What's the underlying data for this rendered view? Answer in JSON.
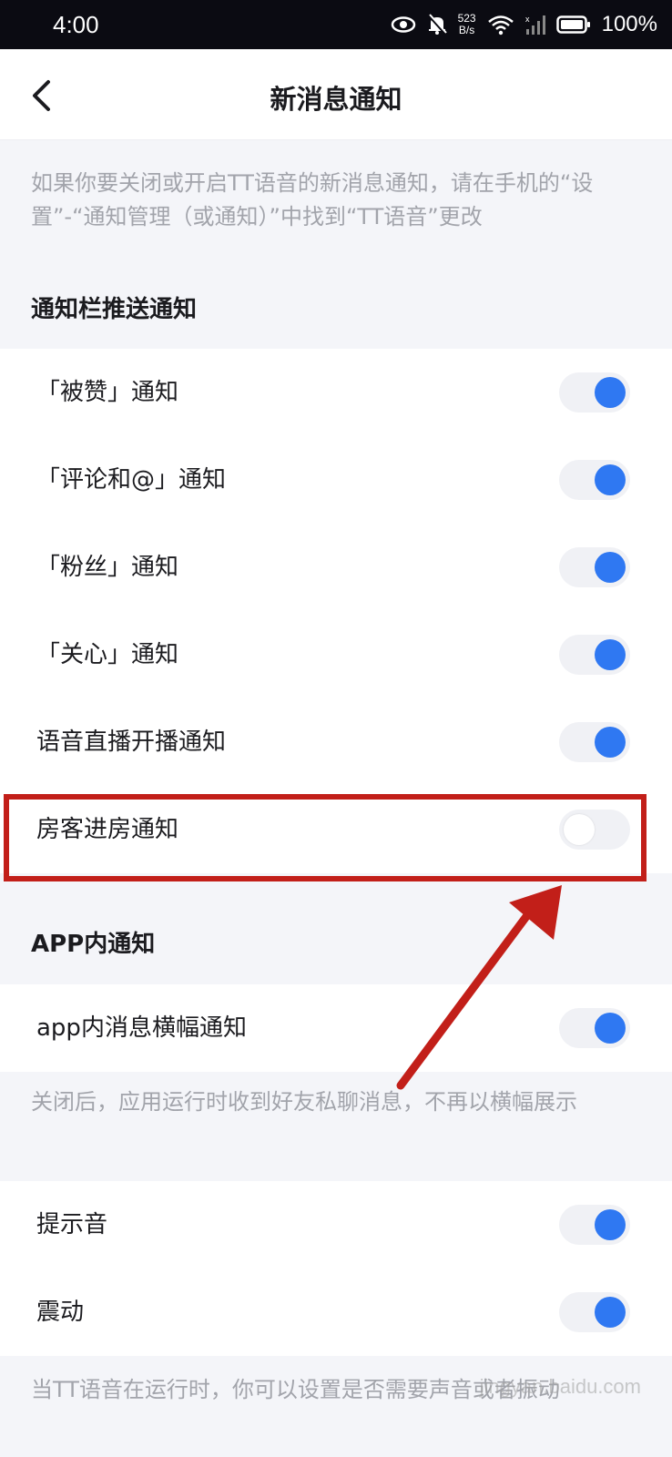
{
  "status_bar": {
    "time": "4:00",
    "net_speed_value": "523",
    "net_speed_unit": "B/s",
    "battery": "100%",
    "icons": [
      "eye-icon",
      "bell-off-icon",
      "wifi-icon",
      "signal-icon",
      "battery-icon"
    ]
  },
  "header": {
    "title": "新消息通知",
    "back_icon": "chevron-left-icon"
  },
  "intro_text": "如果你要关闭或开启TT语音的新消息通知，请在手机的“设置”-“通知管理（或通知）”中找到“TT语音”更改",
  "push_section": {
    "title": "通知栏推送通知",
    "items": [
      {
        "label": "「被赞」通知",
        "on": true
      },
      {
        "label": "「评论和@」通知",
        "on": true
      },
      {
        "label": "「粉丝」通知",
        "on": true
      },
      {
        "label": "「关心」通知",
        "on": true
      },
      {
        "label": "语音直播开播通知",
        "on": true
      },
      {
        "label": "房客进房通知",
        "on": false
      }
    ]
  },
  "app_section": {
    "title": "APP内通知",
    "items": [
      {
        "label": "app内消息横幅通知",
        "on": true
      }
    ],
    "note": "关闭后，应用运行时收到好友私聊消息，不再以横幅展示"
  },
  "sound_section": {
    "items": [
      {
        "label": "提示音",
        "on": true
      },
      {
        "label": "震动",
        "on": true
      }
    ],
    "note": "当TT语音在运行时，你可以设置是否需要声音或者振动"
  },
  "watermark": "jingyan.baidu.com",
  "colors": {
    "accent": "#2f78f2",
    "annotation": "#c21f19",
    "background": "#f4f5f9"
  }
}
